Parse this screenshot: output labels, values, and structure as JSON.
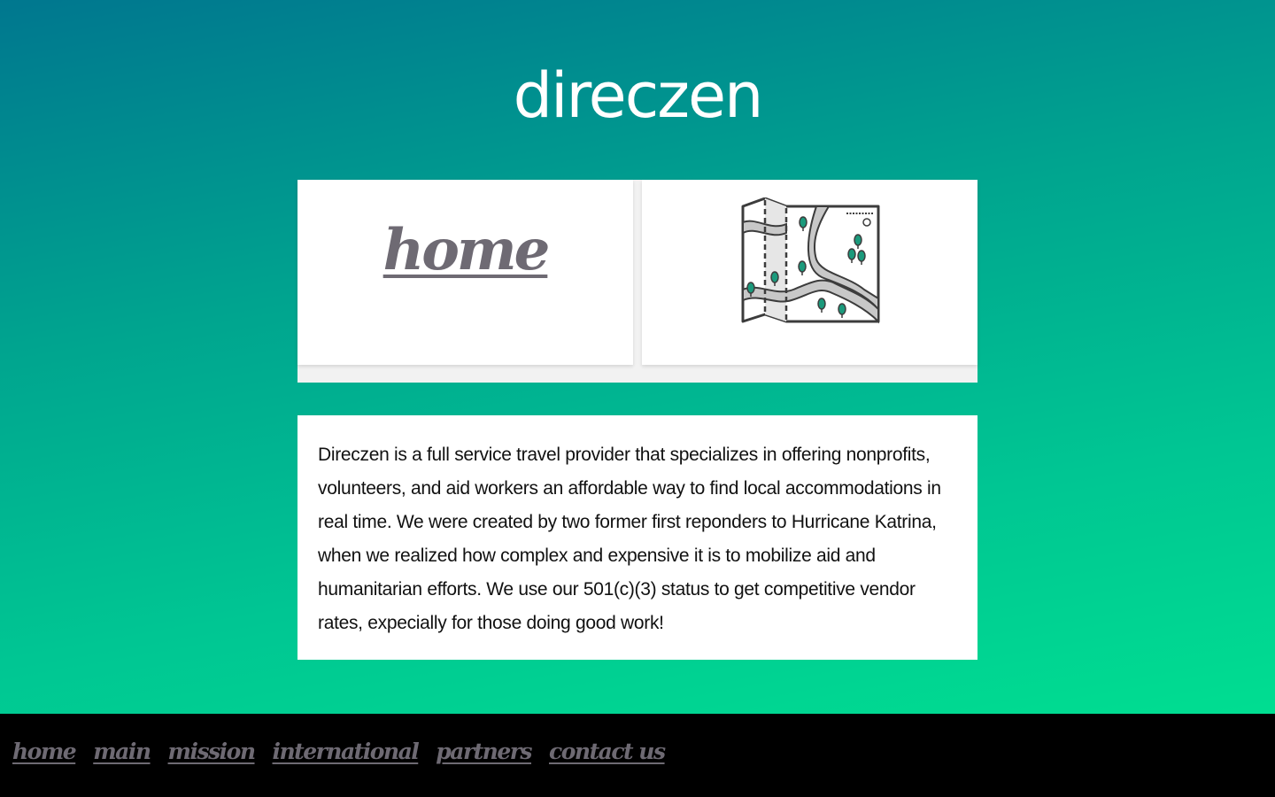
{
  "site": {
    "title": "direczen"
  },
  "hero": {
    "home_link_label": "home",
    "illustration_icon": "folded-map-icon"
  },
  "about": {
    "text": "Direczen is a full service travel provider that specializes in offering nonprofits, volunteers, and aid workers an affordable way to find local accommodations in real time. We were created by two former first reponders to Hurricane Katrina, when we realized how complex and expensive it is to mobilize aid and humanitarian efforts. We use our 501(c)(3) status to get competitive vendor rates, expecially for those doing good work!"
  },
  "footer": {
    "nav": [
      {
        "label": "home"
      },
      {
        "label": "main"
      },
      {
        "label": "mission"
      },
      {
        "label": "international"
      },
      {
        "label": "partners"
      },
      {
        "label": "contact us"
      }
    ]
  },
  "colors": {
    "gradient_top": "#00778f",
    "gradient_bottom": "#00e590",
    "link": "#6e6a73",
    "footer_background": "#000000",
    "tree_green": "#1b9a7c"
  }
}
